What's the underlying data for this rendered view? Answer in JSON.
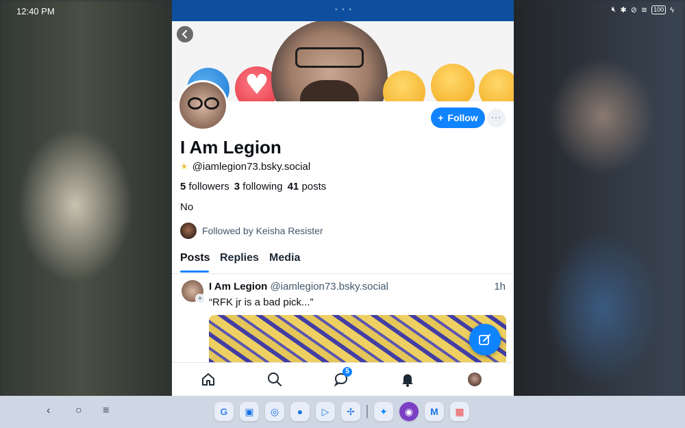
{
  "statusbar": {
    "time": "12:40 PM",
    "battery": "100"
  },
  "profile": {
    "display_name": "I Am Legion",
    "handle_prefix_icon": "sun-icon",
    "handle": "@iamlegion73.bsky.social",
    "followers_count": "5",
    "followers_label": "followers",
    "following_count": "3",
    "following_label": "following",
    "posts_count": "41",
    "posts_label": "posts",
    "bio": "No",
    "followed_by": "Followed by Keisha Resister",
    "follow_label": "Follow",
    "follow_icon": "+",
    "more_label": "···"
  },
  "tabs": [
    {
      "label": "Posts",
      "active": true
    },
    {
      "label": "Replies",
      "active": false
    },
    {
      "label": "Media",
      "active": false
    }
  ],
  "post": {
    "author": "I Am Legion",
    "handle": "@iamlegion73.bsky.social",
    "time": "1h",
    "text": "“RFK jr is a bad pick...”"
  },
  "bottomnav": {
    "items": [
      "home-icon",
      "search-icon",
      "chat-icon",
      "bell-icon",
      "profile-avatar"
    ],
    "chat_badge": "5"
  },
  "colors": {
    "accent": "#1083fe",
    "header_strip": "#0d4f9e",
    "taskbar": "#cfd7e4"
  },
  "dock": {
    "apps": [
      "google-icon",
      "messages-icon",
      "chrome-icon",
      "assistant-icon",
      "play-store-icon",
      "pinwheel-icon",
      "bluesky-icon",
      "beeper-icon",
      "gmail-icon",
      "app-drawer-icon"
    ]
  }
}
